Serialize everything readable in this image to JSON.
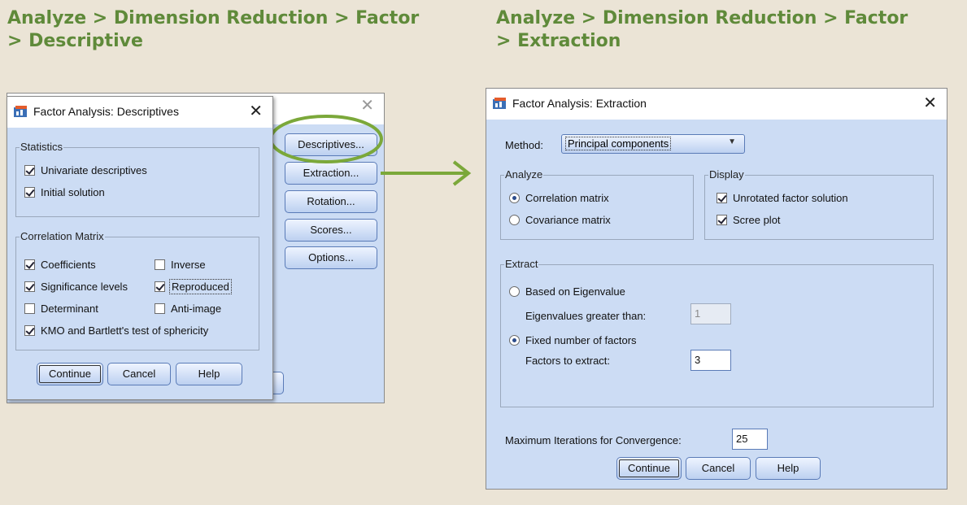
{
  "headings": {
    "left_line1": "Analyze > Dimension Reduction > Factor",
    "left_line2": "> Descriptive",
    "right_line1": "Analyze > Dimension Reduction > Factor",
    "right_line2": "> Extraction"
  },
  "back_window": {
    "buttons": [
      "Descriptives...",
      "Extraction...",
      "Rotation...",
      "Scores...",
      "Options..."
    ],
    "highlight_color": "#7ba83a"
  },
  "descriptives_dialog": {
    "title": "Factor Analysis: Descriptives",
    "statistics_group": "Statistics",
    "univariate": "Univariate descriptives",
    "initial_solution": "Initial solution",
    "correlation_group": "Correlation Matrix",
    "coefficients": "Coefficients",
    "inverse": "Inverse",
    "significance": "Significance levels",
    "reproduced": "Reproduced",
    "determinant": "Determinant",
    "anti_image": "Anti-image",
    "kmo": "KMO and Bartlett's test of sphericity",
    "continue": "Continue",
    "cancel": "Cancel",
    "help": "Help"
  },
  "extraction_dialog": {
    "title": "Factor Analysis: Extraction",
    "method_label": "Method:",
    "method_value": "Principal components",
    "analyze_group": "Analyze",
    "correlation_matrix": "Correlation matrix",
    "covariance_matrix": "Covariance matrix",
    "display_group": "Display",
    "unrotated": "Unrotated factor solution",
    "scree": "Scree plot",
    "extract_group": "Extract",
    "based_eigen": "Based on Eigenvalue",
    "eigen_greater": "Eigenvalues greater than:",
    "eigen_value": "1",
    "fixed_number": "Fixed number of factors",
    "factors_extract": "Factors to extract:",
    "factors_value": "3",
    "max_iter_label": "Maximum Iterations for Convergence:",
    "max_iter_value": "25",
    "continue": "Continue",
    "cancel": "Cancel",
    "help": "Help"
  },
  "arrow_color": "#7ba83a"
}
